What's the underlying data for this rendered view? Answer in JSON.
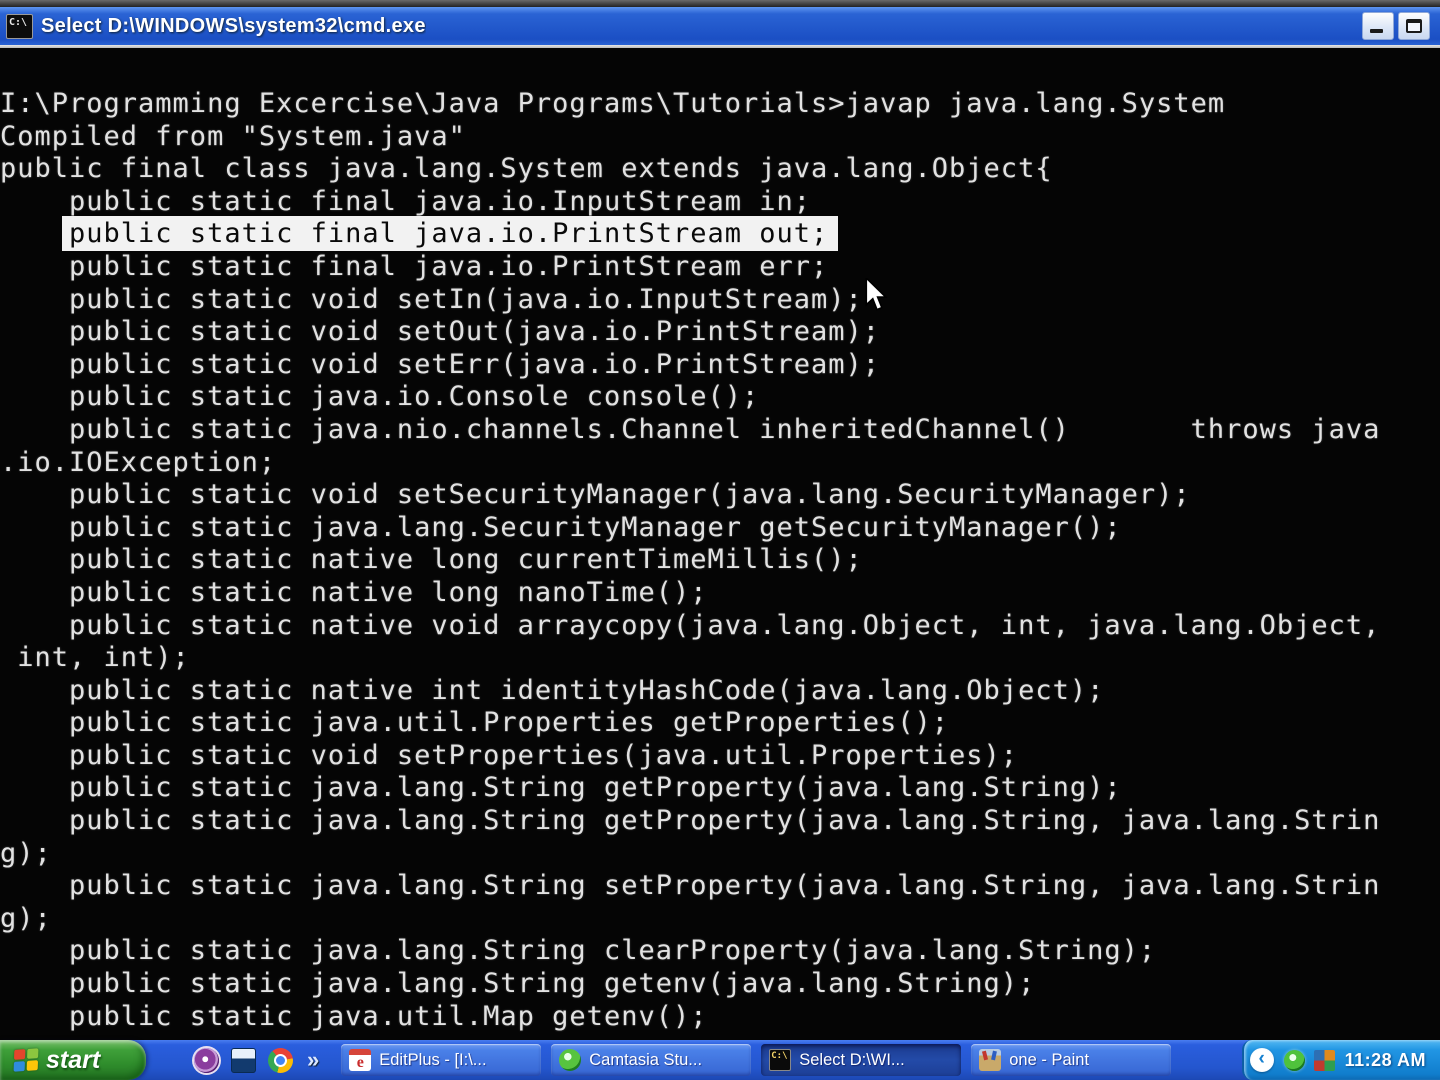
{
  "window": {
    "title": "Select D:\\WINDOWS\\system32\\cmd.exe",
    "icon": "cmd-icon",
    "controls": {
      "minimize": "minimize-button",
      "maximize": "maximize-button"
    }
  },
  "colors": {
    "title_blue": "#2a63d4",
    "taskbar_blue": "#2a5ede",
    "tray_blue": "#2196e4",
    "highlight_bg": "#f2f2f2",
    "console_text": "#e2e2e2"
  },
  "terminal": {
    "lines": [
      {
        "text": "I:\\Programming Excercise\\Java Programs\\Tutorials>javap java.lang.System",
        "highlight": false
      },
      {
        "text": "Compiled from \"System.java\"",
        "highlight": false
      },
      {
        "text": "public final class java.lang.System extends java.lang.Object{",
        "highlight": false
      },
      {
        "text": "    public static final java.io.InputStream in;",
        "highlight": false
      },
      {
        "pre": "    ",
        "text": "public static final java.io.PrintStream out;",
        "highlight": true
      },
      {
        "text": "    public static final java.io.PrintStream err;",
        "highlight": false
      },
      {
        "text": "    public static void setIn(java.io.InputStream);",
        "highlight": false
      },
      {
        "text": "    public static void setOut(java.io.PrintStream);",
        "highlight": false
      },
      {
        "text": "    public static void setErr(java.io.PrintStream);",
        "highlight": false
      },
      {
        "text": "    public static java.io.Console console();",
        "highlight": false
      },
      {
        "text": "    public static java.nio.channels.Channel inheritedChannel()       throws java",
        "highlight": false
      },
      {
        "text": ".io.IOException;",
        "highlight": false
      },
      {
        "text": "    public static void setSecurityManager(java.lang.SecurityManager);",
        "highlight": false
      },
      {
        "text": "    public static java.lang.SecurityManager getSecurityManager();",
        "highlight": false
      },
      {
        "text": "    public static native long currentTimeMillis();",
        "highlight": false
      },
      {
        "text": "    public static native long nanoTime();",
        "highlight": false
      },
      {
        "text": "    public static native void arraycopy(java.lang.Object, int, java.lang.Object,",
        "highlight": false
      },
      {
        "text": " int, int);",
        "highlight": false
      },
      {
        "text": "    public static native int identityHashCode(java.lang.Object);",
        "highlight": false
      },
      {
        "text": "    public static java.util.Properties getProperties();",
        "highlight": false
      },
      {
        "text": "    public static void setProperties(java.util.Properties);",
        "highlight": false
      },
      {
        "text": "    public static java.lang.String getProperty(java.lang.String);",
        "highlight": false
      },
      {
        "text": "    public static java.lang.String getProperty(java.lang.String, java.lang.Strin",
        "highlight": false
      },
      {
        "text": "g);",
        "highlight": false
      },
      {
        "text": "    public static java.lang.String setProperty(java.lang.String, java.lang.Strin",
        "highlight": false
      },
      {
        "text": "g);",
        "highlight": false
      },
      {
        "text": "    public static java.lang.String clearProperty(java.lang.String);",
        "highlight": false
      },
      {
        "text": "    public static java.lang.String getenv(java.lang.String);",
        "highlight": false
      },
      {
        "text": "    public static java.util.Map getenv();",
        "highlight": false
      }
    ]
  },
  "taskbar": {
    "start_label": "start",
    "overflow_chevron": "»",
    "quick_launch": [
      {
        "name": "purple-app-icon",
        "icon": "purple-app"
      },
      {
        "name": "monitor-app-icon",
        "icon": "monitor-app"
      },
      {
        "name": "chrome-icon",
        "icon": "chrome"
      }
    ],
    "buttons": [
      {
        "label": "EditPlus - [I:\\...",
        "icon": "editplus",
        "icon_text": "e",
        "active": false
      },
      {
        "label": "Camtasia Stu...",
        "icon": "camtasia",
        "icon_text": "",
        "active": false
      },
      {
        "label": "Select D:\\WI...",
        "icon": "cmd",
        "icon_text": "C:\\",
        "active": true
      },
      {
        "label": "one - Paint",
        "icon": "paint",
        "icon_text": "",
        "active": false
      }
    ],
    "tray": {
      "chevron": "‹",
      "icons": [
        {
          "name": "camtasia-tray-icon",
          "icon": "camtasia-tray"
        },
        {
          "name": "display-settings-tray-icon",
          "icon": "display-tray"
        }
      ],
      "time": "11:28 AM"
    }
  }
}
